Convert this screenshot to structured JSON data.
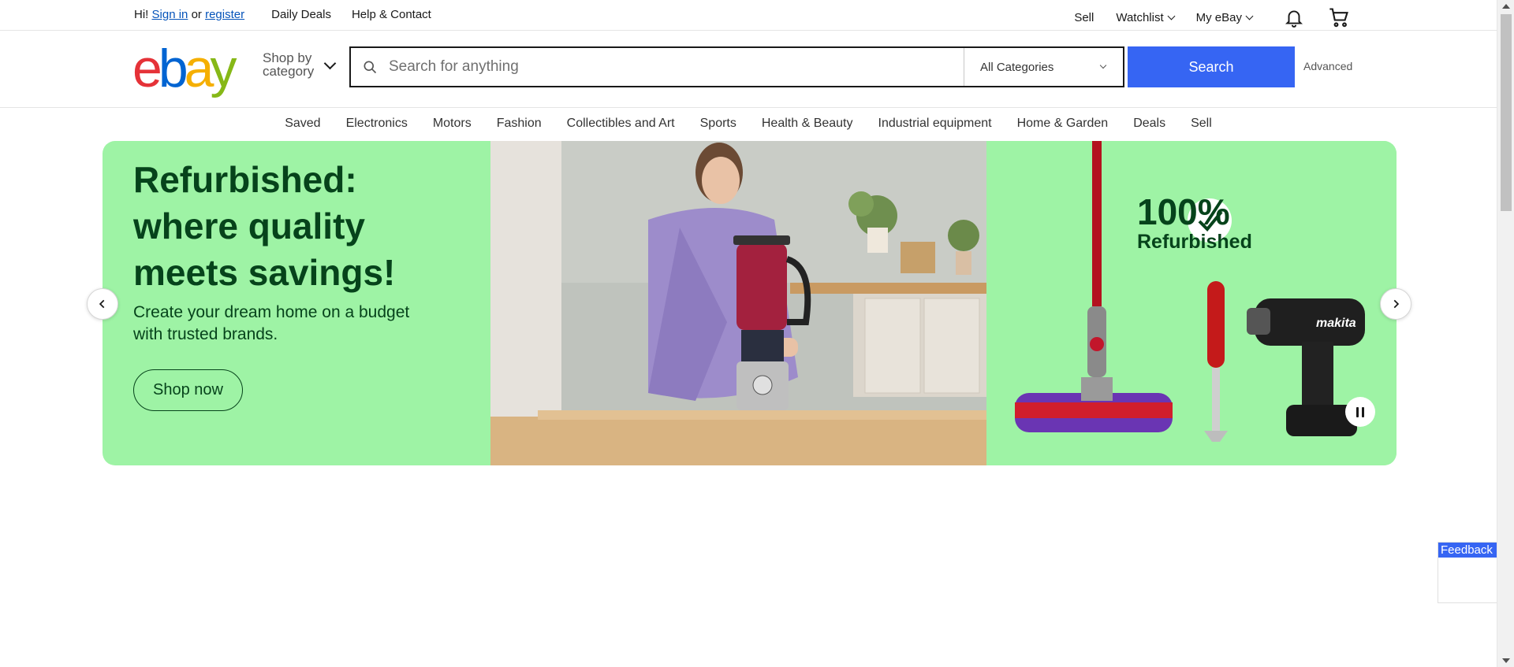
{
  "topbar": {
    "greeting": "Hi!",
    "sign_in": "Sign in",
    "or": "or",
    "register": "register",
    "links": [
      "Daily Deals",
      "Help & Contact"
    ],
    "right": {
      "sell": "Sell",
      "watchlist": "Watchlist",
      "my_ebay": "My eBay"
    }
  },
  "header": {
    "logo": {
      "e": "e",
      "b": "b",
      "a": "a",
      "y": "y"
    },
    "shop_by_line1": "Shop by",
    "shop_by_line2": "category",
    "search": {
      "placeholder": "Search for anything",
      "category": "All Categories",
      "button": "Search"
    },
    "advanced": "Advanced"
  },
  "catnav": [
    "Saved",
    "Electronics",
    "Motors",
    "Fashion",
    "Collectibles and Art",
    "Sports",
    "Health & Beauty",
    "Industrial equipment",
    "Home & Garden",
    "Deals",
    "Sell"
  ],
  "hero": {
    "headline_1": "Refurbished:",
    "headline_2": "where quality",
    "headline_3": "meets savings!",
    "subtext_1": "Create your dream home on a budget",
    "subtext_2": "with trusted brands.",
    "cta": "Shop now",
    "badge_big": "100%",
    "badge_small": "Refurbished",
    "drill_brand": "makita"
  },
  "feedback": "Feedback",
  "colors": {
    "hero_bg": "#9ef3a5",
    "hero_text": "#06431b",
    "search_button": "#3665f3",
    "link": "#0654ba"
  }
}
